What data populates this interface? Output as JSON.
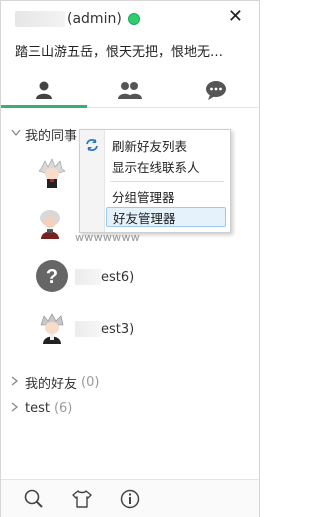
{
  "header": {
    "title": "(admin)",
    "signature": "踏三山游五岳，恨天无把，恨地无…",
    "close_glyph": "✕",
    "status_color": "#2fcd71"
  },
  "tabs": [
    {
      "icon": "contact-icon",
      "active": true
    },
    {
      "icon": "group-icon",
      "active": false
    },
    {
      "icon": "chat-icon",
      "active": false
    }
  ],
  "groups": {
    "g1": {
      "label": "我的同事"
    },
    "g2": {
      "label": "我的好友",
      "count": "(0)"
    },
    "g3": {
      "label": "test",
      "count": "(6)"
    }
  },
  "contacts": {
    "c2_sub": "wwwwwww",
    "c3_suffix": "est6)",
    "c4_suffix": "est3)"
  },
  "context_menu": {
    "refresh": "刷新好友列表",
    "show_online": "显示在线联系人",
    "group_manager": "分组管理器",
    "friend_manager": "好友管理器"
  },
  "footer": {
    "icons": [
      "search-icon",
      "skin-icon",
      "info-icon"
    ]
  },
  "colors": {
    "accent": "#3aae73",
    "menu_hover": "#e5f1fb"
  }
}
